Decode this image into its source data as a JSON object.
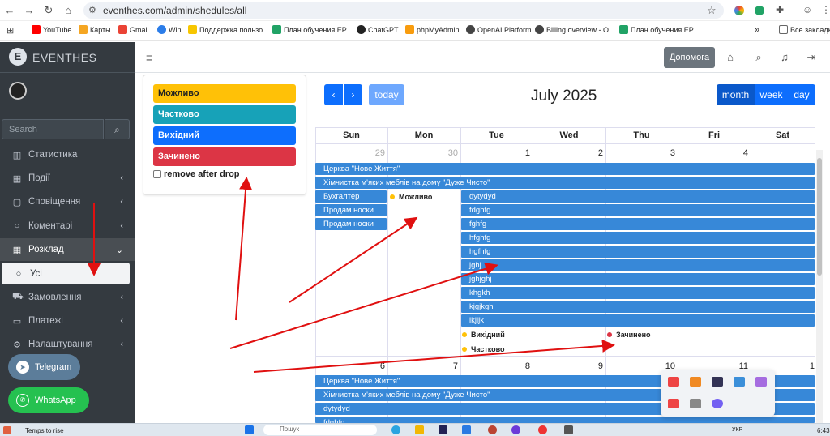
{
  "browser": {
    "url": "eventhes.com/admin/shedules/all",
    "bookmarks": [
      "YouTube",
      "Карты",
      "Gmail",
      "Win",
      "Поддержка пользо...",
      "План обучения EP...",
      "ChatGPT",
      "phpMyAdmin",
      "OpenAI Platform",
      "Billing overview - O...",
      "План обучения EP..."
    ],
    "bookmarks_overflow": "»",
    "all_bookmarks": "Все закладк"
  },
  "sidebar": {
    "brand": "EVENTHES",
    "brand_letter": "E",
    "search_placeholder": "Search",
    "items": [
      {
        "label": "Статистика",
        "icon": "chart-icon"
      },
      {
        "label": "Події",
        "icon": "calendar-icon"
      },
      {
        "label": "Сповіщення",
        "icon": "comment-icon"
      },
      {
        "label": "Коментарі",
        "icon": "comment-icon"
      },
      {
        "label": "Розклад",
        "icon": "calendar-icon"
      },
      {
        "label": "Усі",
        "icon": "circle-icon"
      },
      {
        "label": "Замовлення",
        "icon": "cart-icon"
      },
      {
        "label": "Платежі",
        "icon": "wallet-icon"
      },
      {
        "label": "Налаштування",
        "icon": "gear-icon"
      }
    ],
    "telegram": "Telegram",
    "whatsapp": "WhatsApp"
  },
  "topbar": {
    "help": "Допомога"
  },
  "external_events": {
    "items": [
      {
        "label": "Можливо",
        "color": "#ffc107"
      },
      {
        "label": "Частково",
        "color": "#17a2b8"
      },
      {
        "label": "Вихідний",
        "color": "#0d6efd"
      },
      {
        "label": "Зачинено",
        "color": "#dc3545"
      }
    ],
    "remove_label": "remove after drop"
  },
  "calendar": {
    "title": "July 2025",
    "today": "today",
    "prev": "‹",
    "next": "›",
    "views": [
      "month",
      "week",
      "day"
    ],
    "days": [
      "Sun",
      "Mon",
      "Tue",
      "Wed",
      "Thu",
      "Fri",
      "Sat"
    ],
    "week1_dates": [
      "29",
      "30",
      "1",
      "2",
      "3",
      "4"
    ],
    "week2_dates": [
      "6",
      "7",
      "8",
      "9",
      "10",
      "11",
      "1"
    ],
    "week1_bars_full": [
      "Церква \"Нове Життя\"",
      "Хімчистка м'яких меблів на дому \"Дуже Чисто\""
    ],
    "week1_bars_sun": [
      "Бухгалтер",
      "Продам носки",
      "Продам носки"
    ],
    "week1_bars_tue": [
      "dytydyd",
      "fdghfg",
      "fghfg",
      "hfghfg",
      "hgfhfg",
      "jghj",
      "jghjghj",
      "khgkh",
      "kjgjkgh",
      "lkjljk"
    ],
    "week1_dots": [
      {
        "label": "Можливо",
        "color": "#ffc107"
      },
      {
        "label": "Вихідний",
        "color": "#ffc107"
      },
      {
        "label": "Частково",
        "color": "#ffc107"
      },
      {
        "label": "Зачинено",
        "color": "#dc3545"
      }
    ],
    "week2_bars_full": [
      "Церква \"Нове Життя\"",
      "Хімчистка м'яких меблів на дому \"Дуже Чисто\"",
      "dytydyd",
      "fdghfg"
    ]
  },
  "taskbar": {
    "app": "Temps to rise",
    "search": "Пошук",
    "lang": "УКР",
    "time": "6:43"
  }
}
